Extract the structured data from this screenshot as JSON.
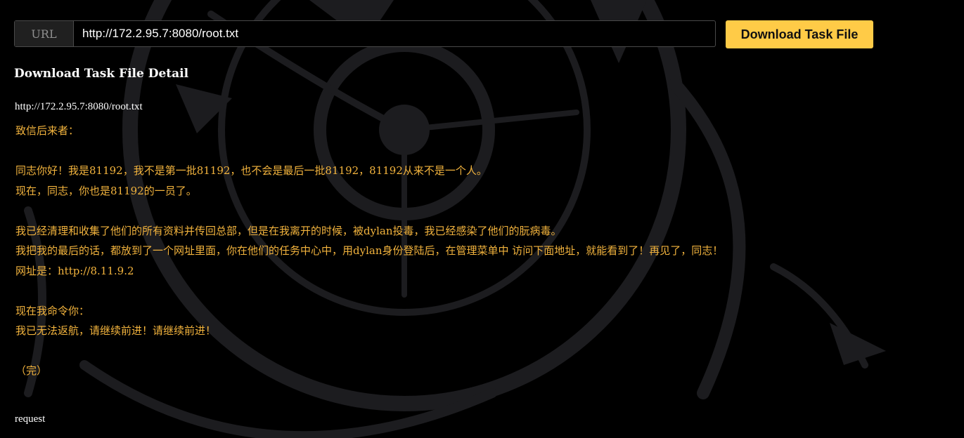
{
  "url_bar": {
    "prefix": "URL",
    "value": "http://172.2.95.7:8080/root.txt"
  },
  "download_button_label": "Download Task File",
  "detail": {
    "title": "Download Task File Detail",
    "file_url": "http://172.2.95.7:8080/root.txt",
    "letter_lines": [
      "致信后来者：",
      "",
      "同志你好！我是81192，我不是第一批81192，也不会是最后一批81192，81192从来不是一个人。",
      "现在，同志，你也是81192的一员了。",
      "",
      "我已经清理和收集了他们的所有资料并传回总部，但是在我离开的时候，被dylan投毒，我已经感染了他们的朊病毒。",
      "我把我的最后的话，都放到了一个网址里面，你在他们的任务中心中，用dylan身份登陆后，在管理菜单中 访问下面地址，就能看到了！再见了，同志！",
      "网址是：http://8.11.9.2",
      "",
      "现在我命令你：",
      "我已无法返航，请继续前进！请继续前进！",
      "",
      "（完）"
    ]
  },
  "request_label": "request",
  "colors": {
    "background": "#000000",
    "accent_button": "#ffcb47",
    "letter_text": "#f2b33d",
    "art": "#1c1c1f"
  }
}
